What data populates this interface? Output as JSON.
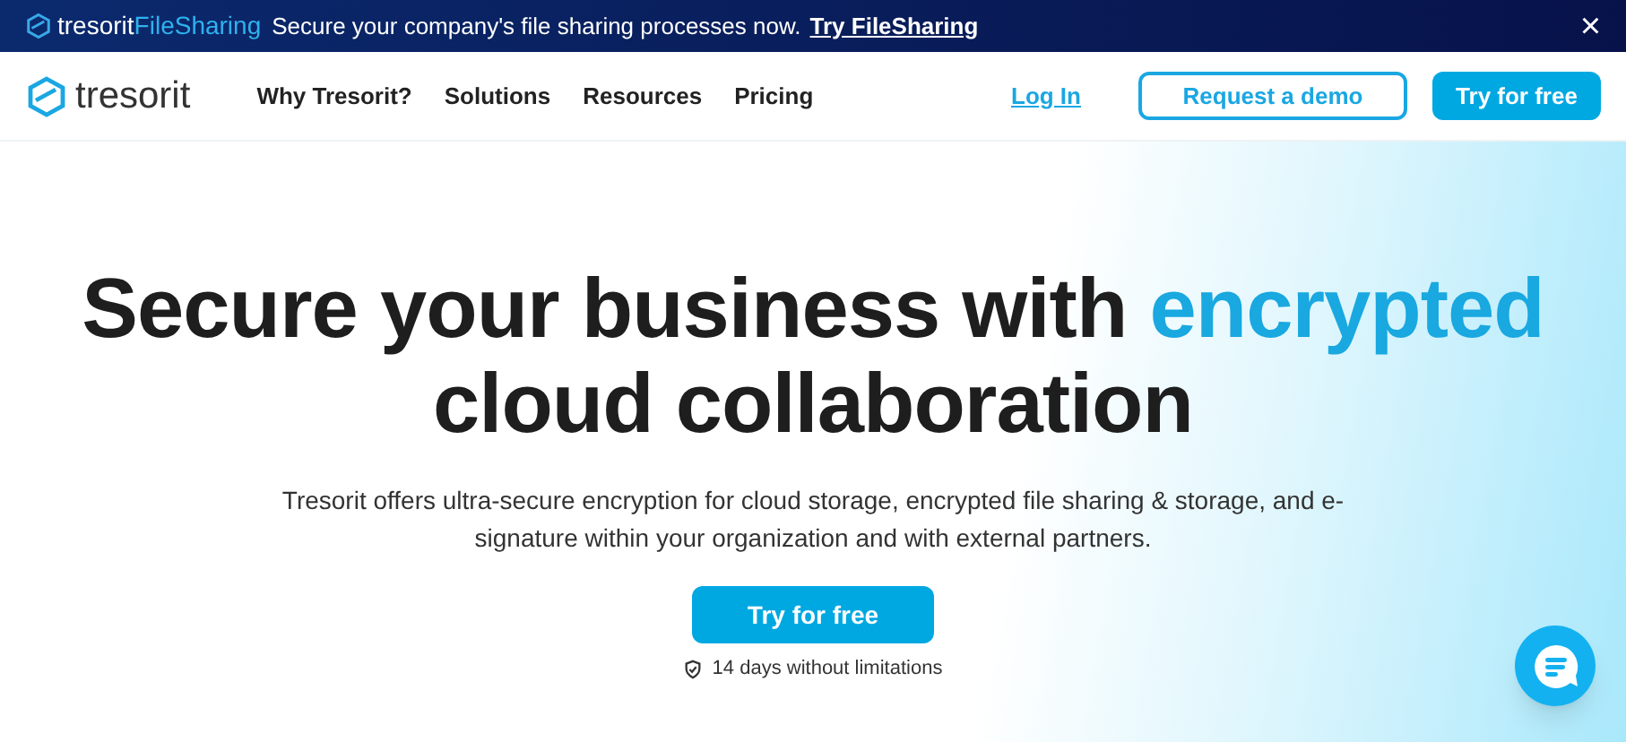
{
  "banner": {
    "brand": "tresorit",
    "product": "FileSharing",
    "message": "Secure your company's file sharing processes now.",
    "link": "Try FileSharing",
    "close": "×"
  },
  "nav": {
    "logo": "tresorit",
    "items": [
      "Why Tresorit?",
      "Solutions",
      "Resources",
      "Pricing"
    ],
    "login": "Log In",
    "demo": "Request a demo",
    "try": "Try for free"
  },
  "hero": {
    "headline_start": "Secure your business with",
    "headline_highlight": "encrypted",
    "headline_end": "cloud collaboration",
    "description": "Tresorit offers ultra-secure encryption for cloud storage, encrypted file sharing & storage, and e-signature within your organization and with external partners.",
    "cta": "Try for free",
    "note": "14 days without limitations"
  }
}
